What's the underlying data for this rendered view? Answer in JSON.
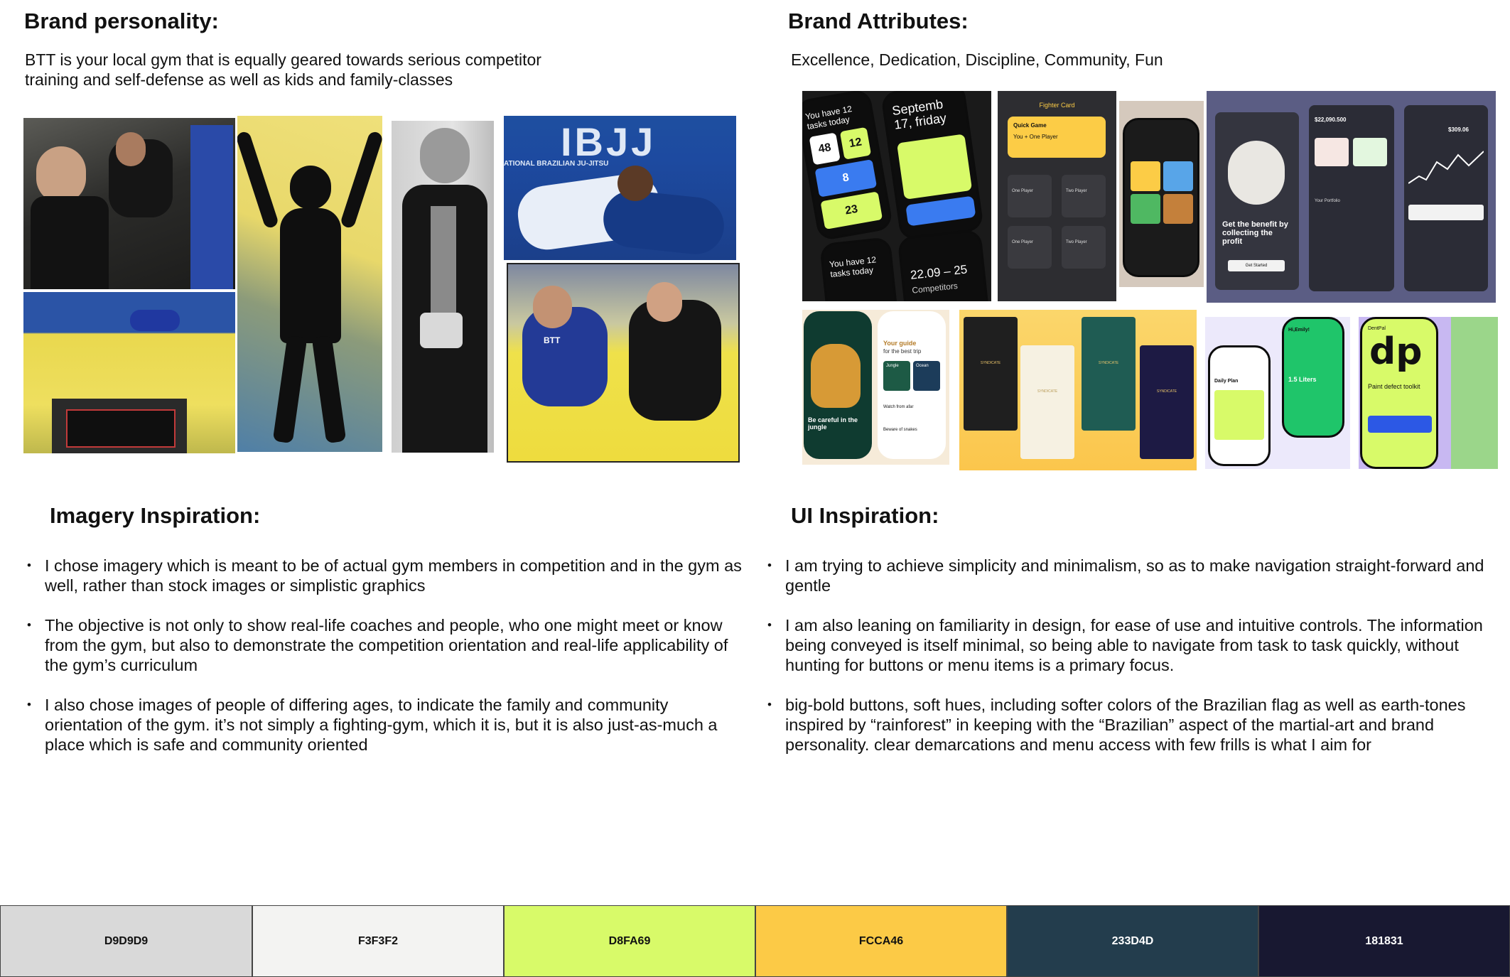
{
  "brand_personality": {
    "heading": "Brand personality:",
    "line1": "BTT is your local gym that is equally geared towards serious competitor",
    "line2": "training and self-defense as well as kids and family-classes"
  },
  "brand_attributes": {
    "heading": "Brand Attributes:",
    "text": "Excellence, Dedication, Discipline, Community, Fun"
  },
  "imagery_inspiration": {
    "heading": "Imagery Inspiration:",
    "bullets": [
      "I chose imagery which is meant to be of actual gym members in competition and in the gym as well, rather than stock images or simplistic graphics",
      "The objective is not only to show real-life coaches and people, who one might meet or know from the gym, but also to demonstrate the competition orientation and real-life applicability of the gym’s curriculum",
      "I also chose images of people of differing ages, to indicate the family and community orientation of the gym.  it’s not simply a fighting-gym, which it is, but it is also just-as-much a place which is safe and community oriented"
    ]
  },
  "ui_inspiration": {
    "heading": "UI Inspiration:",
    "bullets": [
      "I am trying to achieve simplicity and minimalism, so as to make navigation straight-forward and gentle",
      "I am also leaning on familiarity in design, for ease of use and intuitive controls.  The information being conveyed is itself minimal, so being able to navigate from task to task quickly, without hunting for buttons or menu items is a primary focus.",
      "big-bold buttons, soft hues, including softer colors of the Brazilian flag as well as earth-tones inspired by “rainforest” in keeping with the “Brazilian” aspect of the martial-art and brand personality. clear demarcations and menu access with few frills is what I aim for"
    ]
  },
  "photo_texts": {
    "ibjj_banner": "IBJJ",
    "ibjj_sub": "ATIONAL BRAZILIAN JU-JITSU",
    "patch": "BTT"
  },
  "ui_texts": {
    "tasks": "You have 12 tasks today",
    "tasks2": "You have 12 tasks today",
    "date": "Septemb 17, friday",
    "time": "22.09 – 25",
    "competitors": "Competitors",
    "n48": "48",
    "n12": "12",
    "n8": "8",
    "n23": "23",
    "fighter_card": "Fighter Card",
    "quick_game": "Quick Game",
    "one_player_hdr": "You + One Player",
    "one_player": "One Player",
    "two_player": "Two Player",
    "benefit": "Get the benefit by collecting the profit",
    "get_started": "Get Started",
    "balance": "$22,090.500",
    "balance2": "$309.06",
    "portfolio": "Your Portfolio",
    "guide": "Your guide",
    "best_trip": "for the best trip",
    "jungle": "Jungle",
    "ocean": "Ocean",
    "careful": "Be careful in the jungle",
    "watch": "Watch from afar",
    "beware": "Beware of snakes",
    "syndicate": "SYNDICATE",
    "daily_plan": "Daily Plan",
    "hi_emily": "Hi,Emily!",
    "liters": "1.5 Liters",
    "dp": "dp",
    "dentpal": "DentPal",
    "paint": "Paint defect toolkit"
  },
  "palette": [
    {
      "hex": "D9D9D9",
      "color": "#D9D9D9",
      "text": "#111111"
    },
    {
      "hex": "F3F3F2",
      "color": "#F3F3F2",
      "text": "#111111"
    },
    {
      "hex": "D8FA69",
      "color": "#D8FA69",
      "text": "#111111"
    },
    {
      "hex": "FCCA46",
      "color": "#FCCA46",
      "text": "#111111"
    },
    {
      "hex": "233D4D",
      "color": "#233D4D",
      "text": "#ffffff"
    },
    {
      "hex": "181831",
      "color": "#181831",
      "text": "#ffffff"
    }
  ]
}
